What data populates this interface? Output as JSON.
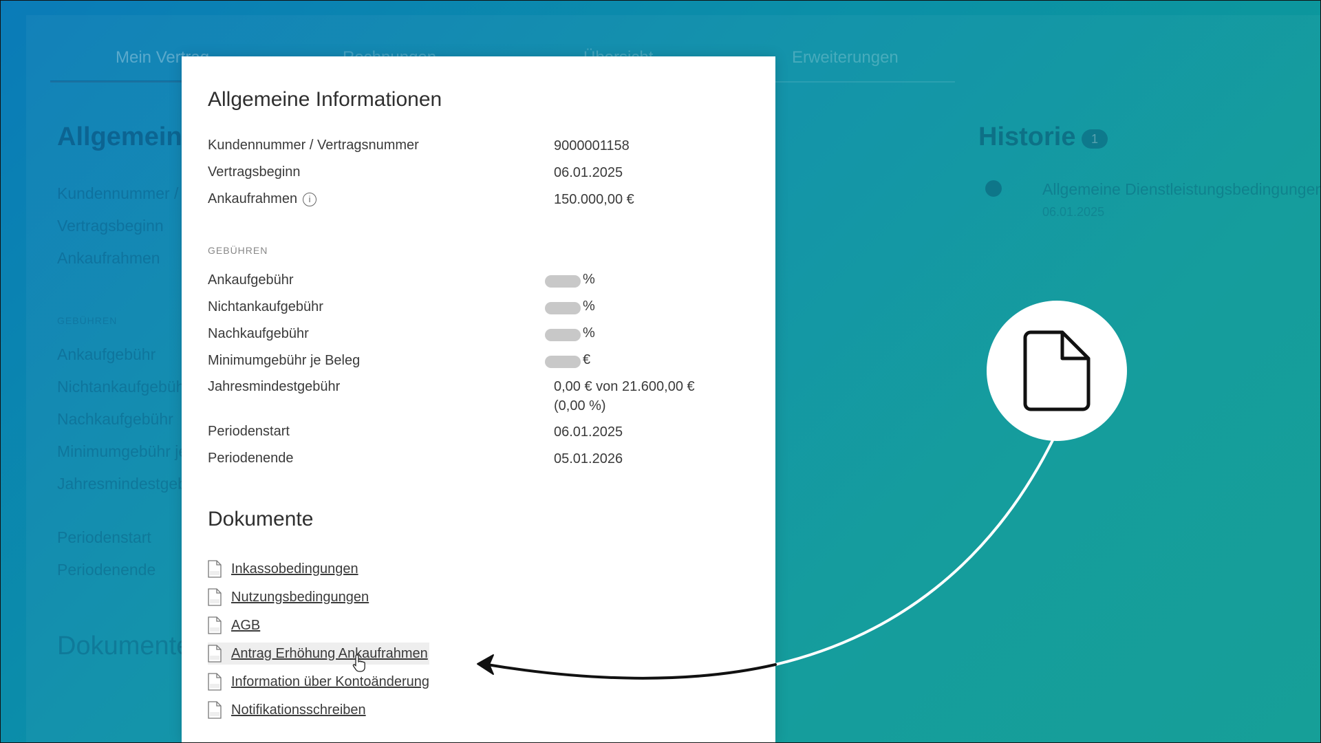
{
  "background_app": {
    "tabs": [
      "Mein Vertrag",
      "Rechnungen",
      "Übersicht",
      "Erweiterungen"
    ],
    "heading_general": "Allgemeine Informationen",
    "rows": [
      "Kundennummer / Vertragsnummer",
      "Vertragsbeginn",
      "Ankaufrahmen"
    ],
    "section_fees": "GEBÜHREN",
    "fee_rows": [
      "Ankaufgebühr",
      "Nichtankaufgebühr",
      "Nachkaufgebühr",
      "Minimumgebühr je Beleg",
      "Jahresmindestgebühr"
    ],
    "period_rows": [
      "Periodenstart",
      "Periodenende"
    ],
    "heading_docs": "Dokumente",
    "history_title": "Historie",
    "history_count": "1",
    "history_item": "Allgemeine Dienstleistungsbedingungen",
    "history_date": "06.01.2025"
  },
  "panel": {
    "title": "Allgemeine Informationen",
    "info_rows": [
      {
        "label": "Kundennummer / Vertragsnummer",
        "value": "9000001158"
      },
      {
        "label": "Vertragsbeginn",
        "value": "06.01.2025"
      },
      {
        "label": "Ankaufrahmen",
        "value": "150.000,00 €"
      }
    ],
    "info_icon_glyph": "i",
    "fees_section": "GEBÜHREN",
    "fee_rows": [
      {
        "label": "Ankaufgebühr",
        "unit": "%"
      },
      {
        "label": "Nichtankaufgebühr",
        "unit": "%"
      },
      {
        "label": "Nachkaufgebühr",
        "unit": "%"
      },
      {
        "label": "Minimumgebühr je Beleg",
        "unit": "€"
      }
    ],
    "annual_fee": {
      "label": "Jahresmindestgebühr",
      "value_line1": "0,00 € von 21.600,00 €",
      "value_line2": "(0,00 %)"
    },
    "period_rows": [
      {
        "label": "Periodenstart",
        "value": "06.01.2025"
      },
      {
        "label": "Periodenende",
        "value": "05.01.2026"
      }
    ],
    "docs_title": "Dokumente",
    "documents": [
      {
        "label": "Inkassobedingungen",
        "file_type": "PDF"
      },
      {
        "label": "Nutzungsbedingungen",
        "file_type": "PDF"
      },
      {
        "label": "AGB",
        "file_type": "PDF"
      },
      {
        "label": "Antrag Erhöhung Ankaufrahmen",
        "file_type": "PDF"
      },
      {
        "label": "Information über Kontoänderung",
        "file_type": "PDF"
      },
      {
        "label": "Notifikationsschreiben",
        "file_type": "DOC"
      }
    ]
  },
  "callout": {
    "icon": "document-icon"
  },
  "colors": {
    "bg_start": "#0a7bb8",
    "bg_end": "#0d9c94",
    "panel": "#ffffff",
    "text": "#3a3a3a"
  }
}
